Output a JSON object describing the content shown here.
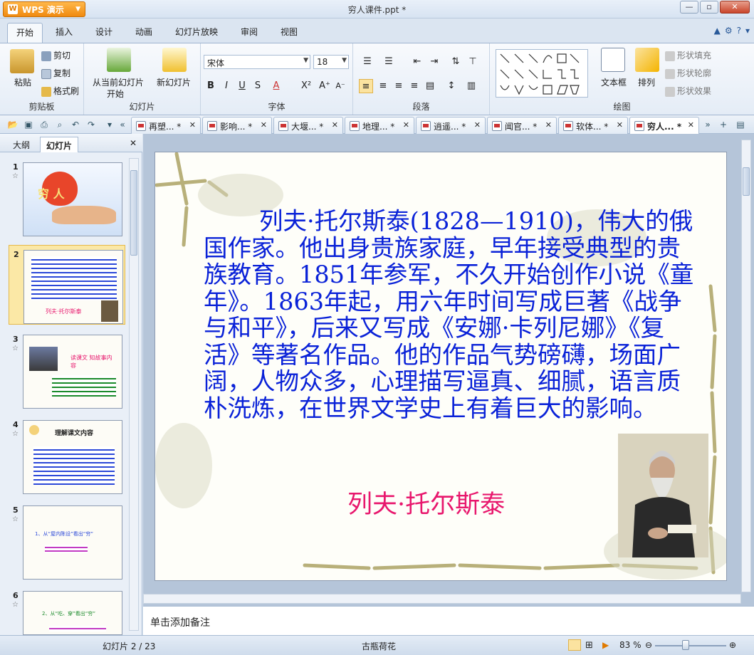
{
  "app": {
    "name": "WPS 演示",
    "window_title": "穷人课件.ppt *"
  },
  "ribbon_tabs": [
    "开始",
    "插入",
    "设计",
    "动画",
    "幻灯片放映",
    "审阅",
    "视图"
  ],
  "ribbon": {
    "clipboard": {
      "paste": "粘贴",
      "cut": "剪切",
      "copy": "复制",
      "format_painter": "格式刷",
      "label": "剪贴板"
    },
    "slides": {
      "from_current_1": "从当前幻灯片",
      "from_current_2": "开始",
      "new_slide": "新幻灯片",
      "label": "幻灯片"
    },
    "font": {
      "name": "宋体",
      "size": "18",
      "label": "字体"
    },
    "paragraph": {
      "label": "段落"
    },
    "drawing": {
      "textbox": "文本框",
      "arrange": "排列",
      "shape_fill": "形状填充",
      "shape_outline": "形状轮廓",
      "shape_effect": "形状效果",
      "label": "绘图"
    }
  },
  "doc_tabs": [
    {
      "label": "再塑... *"
    },
    {
      "label": "影响... *"
    },
    {
      "label": "大堰... *"
    },
    {
      "label": "地理... *"
    },
    {
      "label": "逍遥... *"
    },
    {
      "label": "闻官... *"
    },
    {
      "label": "软体... *"
    },
    {
      "label": "穷人... *",
      "active": true
    }
  ],
  "left_panel": {
    "tab_outline": "大纲",
    "tab_slides": "幻灯片",
    "thumbnails": [
      {
        "num": "1",
        "text": "穷 人"
      },
      {
        "num": "2",
        "text": "列夫·托尔斯泰"
      },
      {
        "num": "3",
        "text": "读课文 知故事内容"
      },
      {
        "num": "4",
        "text": "理解课文内容"
      },
      {
        "num": "5",
        "text": "1、从“屋内陈设”看出“穷”"
      },
      {
        "num": "6",
        "text": "2、从“吃、穿”看出“穷”"
      }
    ]
  },
  "slide": {
    "body": "列夫·托尔斯泰(1828—1910)，伟大的俄国作家。他出身贵族家庭，早年接受典型的贵族教育。1851年参军，不久开始创作小说《童年》。1863年起，用六年时间写成巨著《战争与和平》，后来又写成《安娜·卡列尼娜》《复活》等著名作品。他的作品气势磅礴，场面广阔，人物众多，心理描写逼真、细腻，语言质朴洗炼，在世界文学史上有着巨大的影响。",
    "author_name": "列夫·托尔斯泰"
  },
  "notes_placeholder": "单击添加备注",
  "status": {
    "slide_info": "幻灯片 2 / 23",
    "theme": "古瓶荷花",
    "zoom": "83 %",
    "zoom_level": 0.43
  },
  "colors": {
    "slide_text": "#0a22d8",
    "author": "#e8176d",
    "accent": "#f08a10"
  }
}
